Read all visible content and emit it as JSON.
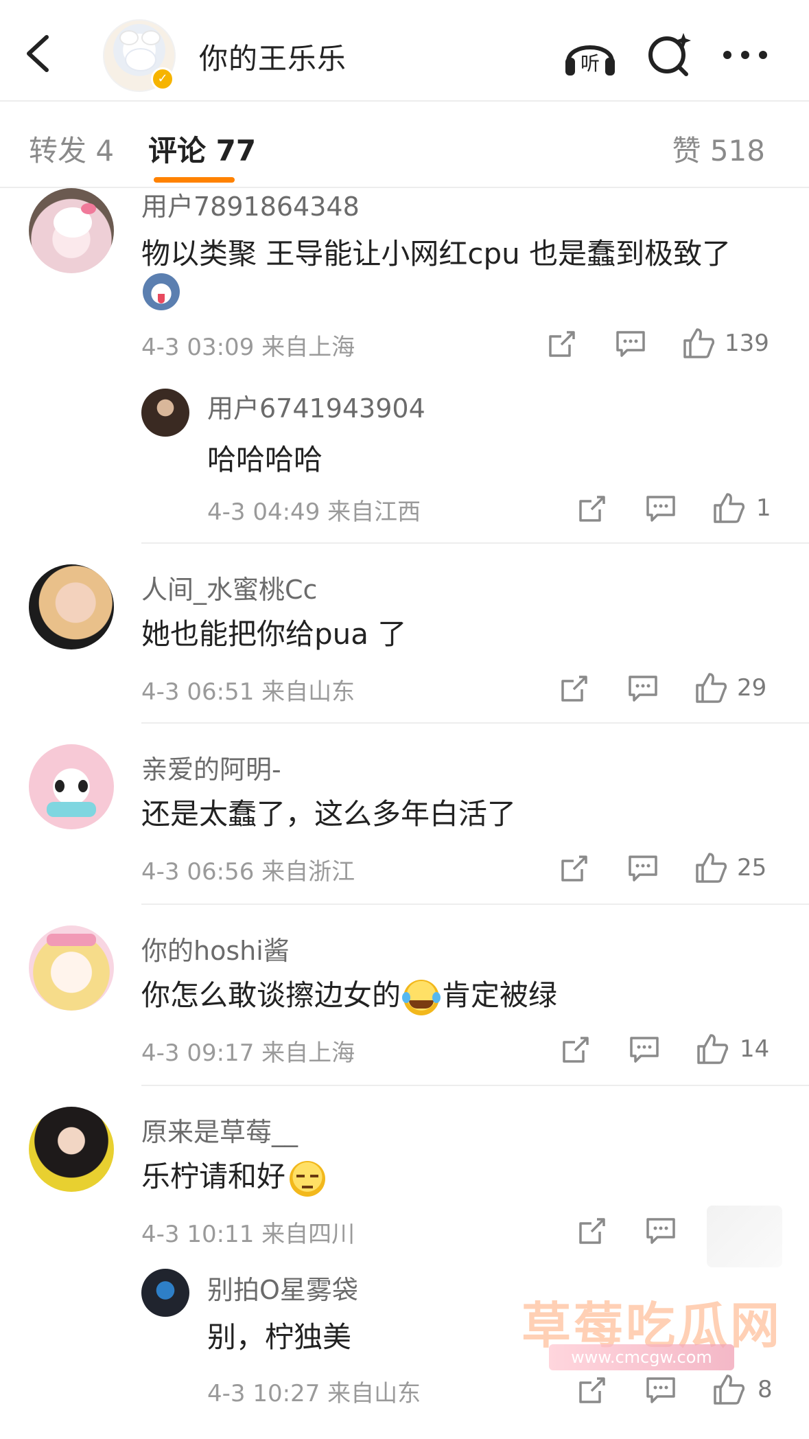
{
  "header": {
    "name": "你的王乐乐",
    "listen_label": "听"
  },
  "tabs": {
    "repost": "转发 4",
    "comment": "评论 77",
    "like": "赞 518"
  },
  "comments": [
    {
      "user": "用户7891864348",
      "text": "物以类聚 王导能让小网红cpu 也是蠢到极致了",
      "time": "4-3 03:09 来自上海",
      "likes": "139",
      "reply": {
        "user": "用户6741943904",
        "text": "哈哈哈哈",
        "time": "4-3 04:49 来自江西",
        "likes": "1"
      }
    },
    {
      "user": "人间_水蜜桃Cc",
      "text": "她也能把你给pua 了",
      "time": "4-3 06:51 来自山东",
      "likes": "29"
    },
    {
      "user": "亲爱的阿明-",
      "text": "还是太蠢了，这么多年白活了",
      "time": "4-3 06:56 来自浙江",
      "likes": "25"
    },
    {
      "user": "你的hoshi酱",
      "text_before": "你怎么敢谈擦边女的",
      "text_after": "肯定被绿",
      "time": "4-3 09:17 来自上海",
      "likes": "14"
    },
    {
      "user": "原来是草莓__",
      "text": "乐柠请和好",
      "time": "4-3 10:11 来自四川",
      "reply": {
        "user": "别拍O星雾袋",
        "text": "别，柠独美",
        "time": "4-3 10:27 来自山东",
        "likes": "8"
      }
    }
  ],
  "watermark": {
    "title": "草莓吃瓜网",
    "url": "www.cmcgw.com"
  },
  "colors": {
    "accent": "#ff8200",
    "verify": "#f6b400",
    "muted_text": "#9a9a9a"
  }
}
